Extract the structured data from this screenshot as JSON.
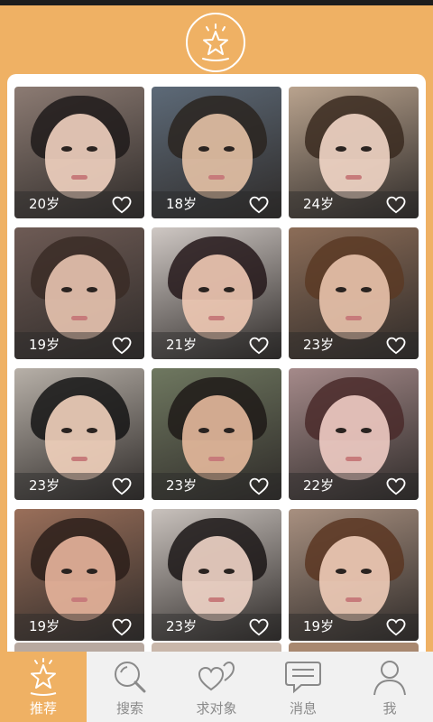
{
  "app": {
    "accent_color": "#efb164",
    "logo_icon": "star-badge-icon"
  },
  "cards": [
    {
      "age": "20岁",
      "skin": "#f1d2c0",
      "hair": "#1f1a1a",
      "bg": "#8c7b73"
    },
    {
      "age": "18岁",
      "skin": "#e6c2a6",
      "hair": "#2a2420",
      "bg": "#5d6a78"
    },
    {
      "age": "24岁",
      "skin": "#f2d6c6",
      "hair": "#3a2a20",
      "bg": "#b9a38e"
    },
    {
      "age": "19岁",
      "skin": "#e8c4b0",
      "hair": "#3a2b26",
      "bg": "#6e5b55"
    },
    {
      "age": "21岁",
      "skin": "#f0c9b4",
      "hair": "#24181a",
      "bg": "#cfc8c4"
    },
    {
      "age": "23岁",
      "skin": "#e9c3ac",
      "hair": "#5a3a25",
      "bg": "#8c6d58"
    },
    {
      "age": "23岁",
      "skin": "#f2d2bd",
      "hair": "#151515",
      "bg": "#b7b0a8"
    },
    {
      "age": "23岁",
      "skin": "#e5b99c",
      "hair": "#1e1a18",
      "bg": "#6f7860"
    },
    {
      "age": "22岁",
      "skin": "#f0ccc4",
      "hair": "#4a2a2a",
      "bg": "#a58a8a"
    },
    {
      "age": "19岁",
      "skin": "#e8b59c",
      "hair": "#2b1e1a",
      "bg": "#9a6f5a"
    },
    {
      "age": "23岁",
      "skin": "#efd4c6",
      "hair": "#1b1616",
      "bg": "#c9c2bd"
    },
    {
      "age": "19岁",
      "skin": "#f0ccb8",
      "hair": "#5a3622",
      "bg": "#a89080"
    }
  ],
  "peek_colors": [
    "#b8a9a0",
    "#c9b7aa",
    "#a88870"
  ],
  "tabs": [
    {
      "label": "推荐",
      "icon": "star-icon",
      "active": true
    },
    {
      "label": "搜索",
      "icon": "search-icon",
      "active": false
    },
    {
      "label": "求对象",
      "icon": "two-hearts-icon",
      "active": false
    },
    {
      "label": "消息",
      "icon": "message-icon",
      "active": false
    },
    {
      "label": "我",
      "icon": "person-icon",
      "active": false
    }
  ]
}
